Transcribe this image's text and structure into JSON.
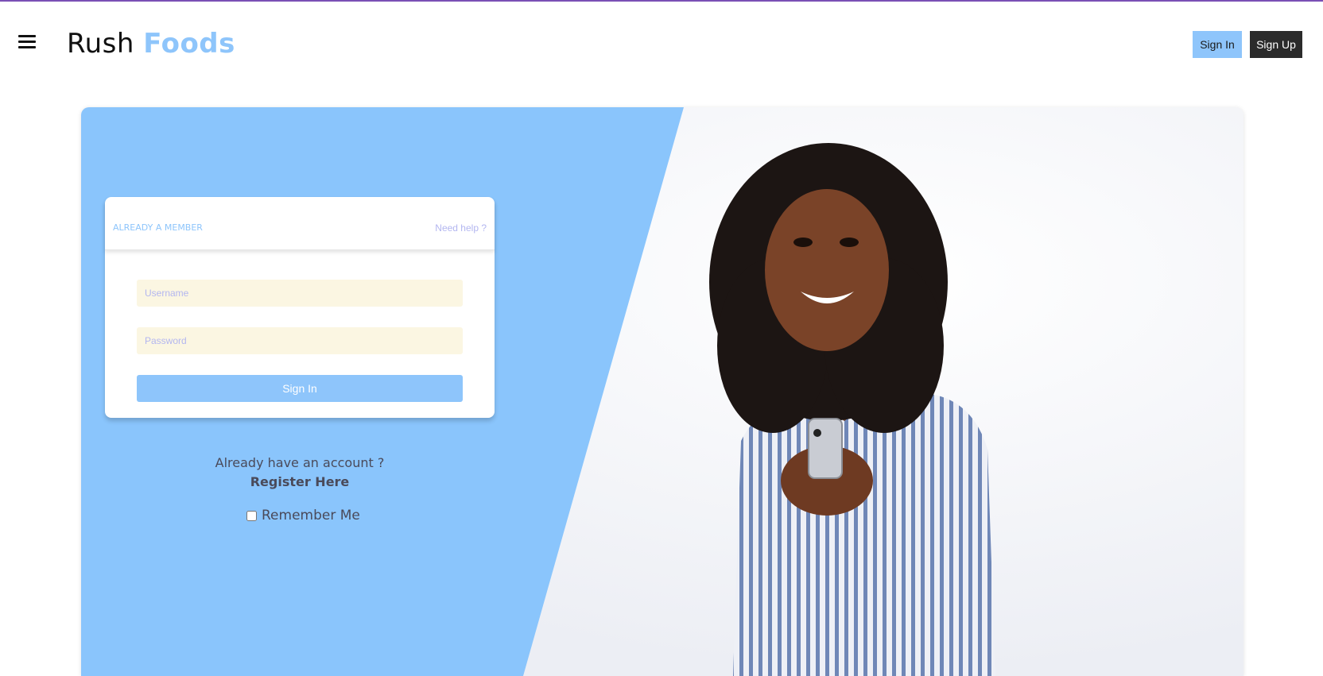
{
  "header": {
    "brand_part1": "Rush",
    "brand_part2": "Foods",
    "sign_in_label": "Sign In",
    "sign_up_label": "Sign Up"
  },
  "login_card": {
    "heading": "ALREADY A MEMBER",
    "help_link": "Need help ?",
    "username_placeholder": "Username",
    "password_placeholder": "Password",
    "submit_label": "Sign In"
  },
  "footer_links": {
    "already_account": "Already have an account ?",
    "register": "Register Here",
    "remember_me": "Remember Me"
  },
  "colors": {
    "accent": "#8ec5fb",
    "dark_button": "#2b2b2b",
    "input_bg": "#fbf6e2",
    "top_border": "#7a4fb5"
  },
  "icons": {
    "menu": "hamburger-menu-icon"
  }
}
